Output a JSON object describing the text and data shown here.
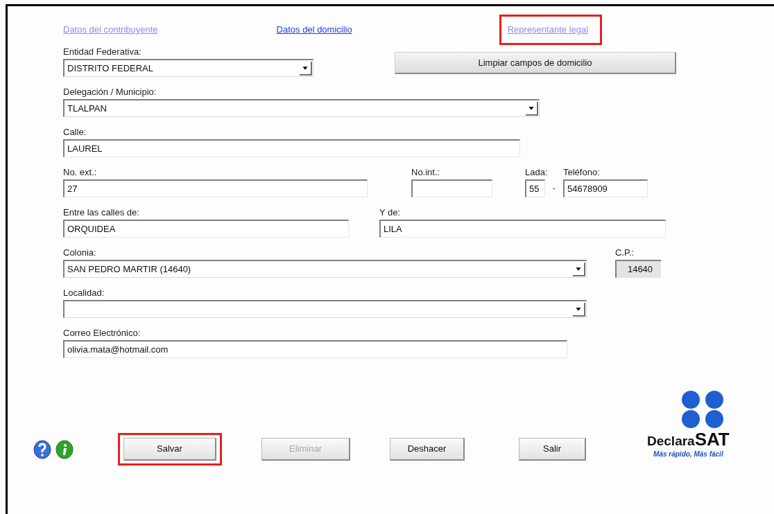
{
  "tabs": [
    {
      "label": "Datos del contribuyente",
      "selected": false,
      "highlighted": false
    },
    {
      "label": "Datos del domicilio",
      "selected": true,
      "highlighted": false
    },
    {
      "label": "Representante legal",
      "selected": false,
      "highlighted": true
    }
  ],
  "clear_button": "Limpiar campos de domicilio",
  "fields": [
    {
      "kind": "select",
      "label": "Entidad Federativa:",
      "value": "DISTRITO FEDERAL"
    },
    {
      "kind": "select",
      "label": "Delegación / Municipio:",
      "value": "TLALPAN"
    },
    {
      "kind": "text",
      "label": "Calle:",
      "value": "LAUREL"
    },
    {
      "kind": "text",
      "label": "No. ext.:",
      "value": "27"
    },
    {
      "kind": "text",
      "label": "No.int.:"
    },
    {
      "kind": "text",
      "label": "Lada:",
      "value": "55",
      "suffix": "-"
    },
    {
      "kind": "text",
      "label": "Teléfono:",
      "value": "54678909"
    },
    {
      "kind": "text",
      "label": "Entre las calles de:",
      "value": "ORQUIDEA"
    },
    {
      "kind": "text",
      "label": "Y de:",
      "value": "LILA"
    },
    {
      "kind": "select",
      "label": "Colonia:",
      "value": "SAN PEDRO MARTIR (14640)"
    },
    {
      "kind": "readonly",
      "label": "C.P.:",
      "value": "14640"
    },
    {
      "kind": "select",
      "label": "Localidad:"
    },
    {
      "kind": "text",
      "label": "Correo Electrónico:",
      "value": "olivia.mata@hotmail.com"
    }
  ],
  "buttons": [
    {
      "label": "Salvar",
      "disabled": false,
      "highlighted": true
    },
    {
      "label": "Eliminar",
      "disabled": true,
      "highlighted": false
    },
    {
      "label": "Deshacer",
      "disabled": false,
      "highlighted": false
    },
    {
      "label": "Salir",
      "disabled": false,
      "highlighted": false
    }
  ],
  "logo": {
    "word": "Declara",
    "mark": "SAT",
    "tagline": "Más rápido, Más fácil"
  }
}
